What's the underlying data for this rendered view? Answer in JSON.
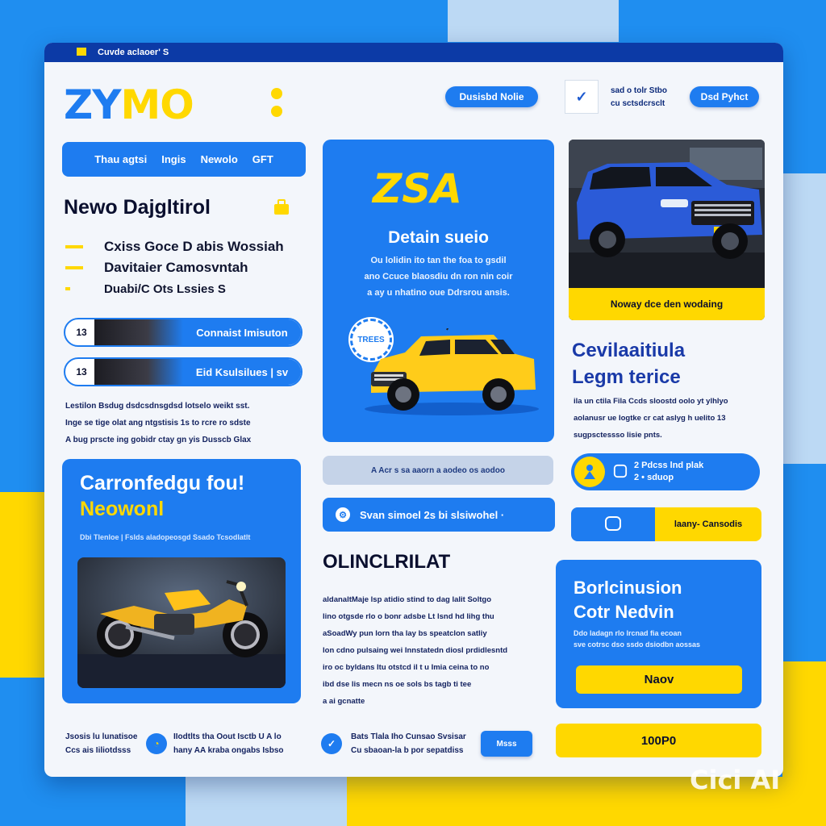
{
  "window": {
    "title": "Cuvde aclaoer' S"
  },
  "brand": {
    "logo_a": "ZY",
    "logo_b": "MO"
  },
  "header": {
    "button_left": "Dusisbd Nolie",
    "check_glyph": "✓",
    "info_line1": "sad o tolr  Stbo",
    "info_line2": "cu  sctsdcrsclt",
    "button_right": "Dsd Pyhct"
  },
  "nav": {
    "items": [
      "Thau agtsi",
      "Ingis",
      "Newolo",
      "GFT"
    ]
  },
  "left": {
    "heading": "Newo Dajgltirol",
    "list": [
      "Cxiss Goce  D abis Wossiah",
      "Davitaier Camosvntah",
      "Duabi/C Ots Lssies S"
    ],
    "pills": [
      {
        "num": "13",
        "label": "Connaist Imisuton"
      },
      {
        "num": "13",
        "label": "Eid Ksulsilues  |  sv"
      }
    ],
    "paragraph": [
      "Lestilon Bsdug dsdcsdnsgdsd lotselo weikt sst.",
      "Inge se tige olat ang ntgstisis 1s to rcre ro sdste",
      "A bug prscte ing gobidr ctay gn yis Dusscb Glax"
    ]
  },
  "promo": {
    "logo": "ZSA",
    "subtitle": "Detain sueio",
    "body": [
      "Ou lolidin ito tan the foa to gsdil",
      "ano Ccuce blaosdiu dn ron nin coir",
      "a ay u nhatino oue Ddrsrou ansis."
    ],
    "badge": "TREES"
  },
  "divider": {
    "text": "A Acr s sa aaorn a aodeo os aodoo"
  },
  "searchbar": {
    "icon": "⚙",
    "text": "Svan simoel 2s  bi slsiwohel  ·"
  },
  "middle": {
    "heading": "OLINCLRILAT",
    "paragraph": [
      "aldanaltMaje lsp atidio stind to dag lalit Soltgo",
      "lino otgsde rlo o bonr adsbe Lt lsnd hd lihg thu",
      "aSoadWy pun lorn tha lay bs speatclon satliy",
      "lon cdno pulsaing wei Innstatedn diosl prdidlesntd",
      "iro oc byldans ltu otstcd il t u Imia ceina to no",
      "ibd dse lis mecn ns oe sols bs tagb ti tee",
      "a ai gcnatte"
    ]
  },
  "offer": {
    "heading": "Carronfedgu fou!",
    "subheading": "Neowonl",
    "caption": "Dbi Tlenloe | Fslds aladopeosgd Ssado Tcsodlatlt"
  },
  "vehicle": {
    "caption": "Noway dce den wodaing"
  },
  "right": {
    "heading_line1": "Cevilaaitiula",
    "heading_line2": "Legm terice",
    "paragraph": [
      "ila un ctila Fila Ccds sloostd oolo yt ylhlyo",
      "aolanusr ue Iogtke cr cat aslyg h uelito 13",
      "sugpsctessso lisie pnts."
    ],
    "pill_line1": "2 Pdcss lnd plak",
    "pill_line2": "2 • sduop",
    "split_label": "laany- Cansodis"
  },
  "bottom_card": {
    "heading_line1": "Borlcinusion",
    "heading_line2": "Cotr Nedvin",
    "body_line1": "Ddo ladagn rlo lrcnad fia ecoan",
    "body_line2": "sve cotrsc dso ssdo dsiodbn aossas",
    "button": "Naov"
  },
  "footer": {
    "left_line1": "Jsosis lu lunatisoe",
    "left_line2": "Ccs ais Iiliotdsss",
    "mid_line1": "IIodtlts tha Oout Isctb U A lo",
    "mid_line2": "hany AA kraba ongabs Isbso",
    "check_line1": "Bats Tlala Iho Cunsao Svsisar",
    "check_line2": "Cu sbaoan-la b por sepatdiss",
    "small_button": "Msss",
    "price_button": "100P0"
  },
  "watermark": "Cici AI",
  "colors": {
    "accent_blue": "#1e7cf0",
    "accent_yellow": "#ffd800",
    "dark_navy": "#0c3aa6"
  }
}
